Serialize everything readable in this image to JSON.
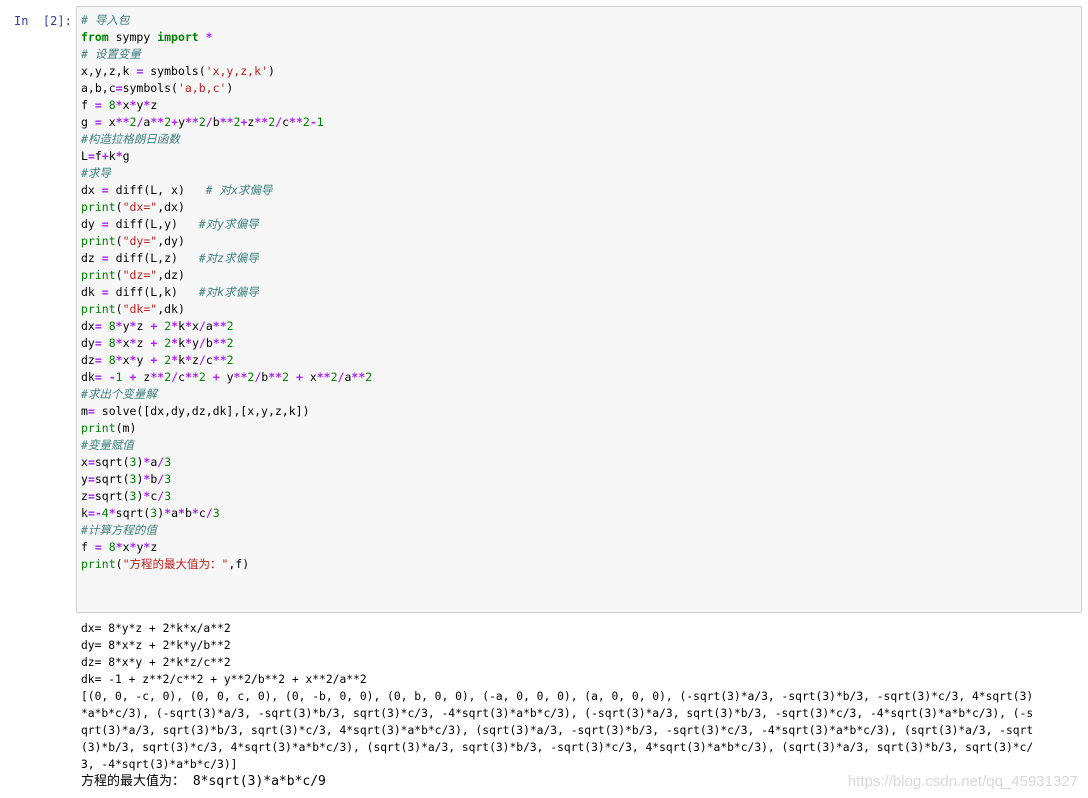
{
  "cell": {
    "prompt": "In  [2]:",
    "code_lines": [
      [
        [
          "c",
          "# 导入包"
        ]
      ],
      [
        [
          "k",
          "from"
        ],
        [
          "v",
          " sympy "
        ],
        [
          "k",
          "import"
        ],
        [
          "v",
          " "
        ],
        [
          "o",
          "*"
        ]
      ],
      [
        [
          "c",
          "# 设置变量"
        ]
      ],
      [
        [
          "v",
          "x,y,z,k "
        ],
        [
          "o",
          "="
        ],
        [
          "v",
          " symbols("
        ],
        [
          "s",
          "'x,y,z,k'"
        ],
        [
          "v",
          ")"
        ]
      ],
      [
        [
          "v",
          "a,b,c"
        ],
        [
          "o",
          "="
        ],
        [
          "v",
          "symbols("
        ],
        [
          "s",
          "'a,b,c'"
        ],
        [
          "v",
          ")"
        ]
      ],
      [
        [
          "v",
          "f "
        ],
        [
          "o",
          "="
        ],
        [
          "v",
          " "
        ],
        [
          "n",
          "8"
        ],
        [
          "o",
          "*"
        ],
        [
          "v",
          "x"
        ],
        [
          "o",
          "*"
        ],
        [
          "v",
          "y"
        ],
        [
          "o",
          "*"
        ],
        [
          "v",
          "z"
        ]
      ],
      [
        [
          "v",
          "g "
        ],
        [
          "o",
          "="
        ],
        [
          "v",
          " x"
        ],
        [
          "o",
          "**"
        ],
        [
          "n",
          "2"
        ],
        [
          "o",
          "/"
        ],
        [
          "v",
          "a"
        ],
        [
          "o",
          "**"
        ],
        [
          "n",
          "2"
        ],
        [
          "o",
          "+"
        ],
        [
          "v",
          "y"
        ],
        [
          "o",
          "**"
        ],
        [
          "n",
          "2"
        ],
        [
          "o",
          "/"
        ],
        [
          "v",
          "b"
        ],
        [
          "o",
          "**"
        ],
        [
          "n",
          "2"
        ],
        [
          "o",
          "+"
        ],
        [
          "v",
          "z"
        ],
        [
          "o",
          "**"
        ],
        [
          "n",
          "2"
        ],
        [
          "o",
          "/"
        ],
        [
          "v",
          "c"
        ],
        [
          "o",
          "**"
        ],
        [
          "n",
          "2"
        ],
        [
          "o",
          "-"
        ],
        [
          "n",
          "1"
        ]
      ],
      [
        [
          "c",
          "#构造拉格朗日函数"
        ]
      ],
      [
        [
          "v",
          "L"
        ],
        [
          "o",
          "="
        ],
        [
          "v",
          "f"
        ],
        [
          "o",
          "+"
        ],
        [
          "v",
          "k"
        ],
        [
          "o",
          "*"
        ],
        [
          "v",
          "g"
        ]
      ],
      [
        [
          "c",
          "#求导"
        ]
      ],
      [
        [
          "v",
          "dx "
        ],
        [
          "o",
          "="
        ],
        [
          "v",
          " diff(L, x)   "
        ],
        [
          "c",
          "# 对x求偏导"
        ]
      ],
      [
        [
          "b",
          "print"
        ],
        [
          "v",
          "("
        ],
        [
          "s",
          "\"dx=\""
        ],
        [
          "v",
          ",dx)"
        ]
      ],
      [
        [
          "v",
          "dy "
        ],
        [
          "o",
          "="
        ],
        [
          "v",
          " diff(L,y)   "
        ],
        [
          "c",
          "#对y求偏导"
        ]
      ],
      [
        [
          "b",
          "print"
        ],
        [
          "v",
          "("
        ],
        [
          "s",
          "\"dy=\""
        ],
        [
          "v",
          ",dy)"
        ]
      ],
      [
        [
          "v",
          "dz "
        ],
        [
          "o",
          "="
        ],
        [
          "v",
          " diff(L,z)   "
        ],
        [
          "c",
          "#对z求偏导"
        ]
      ],
      [
        [
          "b",
          "print"
        ],
        [
          "v",
          "("
        ],
        [
          "s",
          "\"dz=\""
        ],
        [
          "v",
          ",dz)"
        ]
      ],
      [
        [
          "v",
          "dk "
        ],
        [
          "o",
          "="
        ],
        [
          "v",
          " diff(L,k)   "
        ],
        [
          "c",
          "#对k求偏导"
        ]
      ],
      [
        [
          "b",
          "print"
        ],
        [
          "v",
          "("
        ],
        [
          "s",
          "\"dk=\""
        ],
        [
          "v",
          ",dk)"
        ]
      ],
      [
        [
          "v",
          "dx"
        ],
        [
          "o",
          "="
        ],
        [
          "v",
          " "
        ],
        [
          "n",
          "8"
        ],
        [
          "o",
          "*"
        ],
        [
          "v",
          "y"
        ],
        [
          "o",
          "*"
        ],
        [
          "v",
          "z "
        ],
        [
          "o",
          "+"
        ],
        [
          "v",
          " "
        ],
        [
          "n",
          "2"
        ],
        [
          "o",
          "*"
        ],
        [
          "v",
          "k"
        ],
        [
          "o",
          "*"
        ],
        [
          "v",
          "x"
        ],
        [
          "o",
          "/"
        ],
        [
          "v",
          "a"
        ],
        [
          "o",
          "**"
        ],
        [
          "n",
          "2"
        ]
      ],
      [
        [
          "v",
          "dy"
        ],
        [
          "o",
          "="
        ],
        [
          "v",
          " "
        ],
        [
          "n",
          "8"
        ],
        [
          "o",
          "*"
        ],
        [
          "v",
          "x"
        ],
        [
          "o",
          "*"
        ],
        [
          "v",
          "z "
        ],
        [
          "o",
          "+"
        ],
        [
          "v",
          " "
        ],
        [
          "n",
          "2"
        ],
        [
          "o",
          "*"
        ],
        [
          "v",
          "k"
        ],
        [
          "o",
          "*"
        ],
        [
          "v",
          "y"
        ],
        [
          "o",
          "/"
        ],
        [
          "v",
          "b"
        ],
        [
          "o",
          "**"
        ],
        [
          "n",
          "2"
        ]
      ],
      [
        [
          "v",
          "dz"
        ],
        [
          "o",
          "="
        ],
        [
          "v",
          " "
        ],
        [
          "n",
          "8"
        ],
        [
          "o",
          "*"
        ],
        [
          "v",
          "x"
        ],
        [
          "o",
          "*"
        ],
        [
          "v",
          "y "
        ],
        [
          "o",
          "+"
        ],
        [
          "v",
          " "
        ],
        [
          "n",
          "2"
        ],
        [
          "o",
          "*"
        ],
        [
          "v",
          "k"
        ],
        [
          "o",
          "*"
        ],
        [
          "v",
          "z"
        ],
        [
          "o",
          "/"
        ],
        [
          "v",
          "c"
        ],
        [
          "o",
          "**"
        ],
        [
          "n",
          "2"
        ]
      ],
      [
        [
          "v",
          "dk"
        ],
        [
          "o",
          "="
        ],
        [
          "v",
          " "
        ],
        [
          "o",
          "-"
        ],
        [
          "n",
          "1"
        ],
        [
          "v",
          " "
        ],
        [
          "o",
          "+"
        ],
        [
          "v",
          " z"
        ],
        [
          "o",
          "**"
        ],
        [
          "n",
          "2"
        ],
        [
          "o",
          "/"
        ],
        [
          "v",
          "c"
        ],
        [
          "o",
          "**"
        ],
        [
          "n",
          "2"
        ],
        [
          "v",
          " "
        ],
        [
          "o",
          "+"
        ],
        [
          "v",
          " y"
        ],
        [
          "o",
          "**"
        ],
        [
          "n",
          "2"
        ],
        [
          "o",
          "/"
        ],
        [
          "v",
          "b"
        ],
        [
          "o",
          "**"
        ],
        [
          "n",
          "2"
        ],
        [
          "v",
          " "
        ],
        [
          "o",
          "+"
        ],
        [
          "v",
          " x"
        ],
        [
          "o",
          "**"
        ],
        [
          "n",
          "2"
        ],
        [
          "o",
          "/"
        ],
        [
          "v",
          "a"
        ],
        [
          "o",
          "**"
        ],
        [
          "n",
          "2"
        ]
      ],
      [
        [
          "c",
          "#求出个变量解"
        ]
      ],
      [
        [
          "v",
          "m"
        ],
        [
          "o",
          "="
        ],
        [
          "v",
          " solve([dx,dy,dz,dk],[x,y,z,k])"
        ]
      ],
      [
        [
          "b",
          "print"
        ],
        [
          "v",
          "(m)"
        ]
      ],
      [
        [
          "c",
          "#变量赋值"
        ]
      ],
      [
        [
          "v",
          "x"
        ],
        [
          "o",
          "="
        ],
        [
          "v",
          "sqrt("
        ],
        [
          "n",
          "3"
        ],
        [
          "v",
          ")"
        ],
        [
          "o",
          "*"
        ],
        [
          "v",
          "a"
        ],
        [
          "o",
          "/"
        ],
        [
          "n",
          "3"
        ]
      ],
      [
        [
          "v",
          "y"
        ],
        [
          "o",
          "="
        ],
        [
          "v",
          "sqrt("
        ],
        [
          "n",
          "3"
        ],
        [
          "v",
          ")"
        ],
        [
          "o",
          "*"
        ],
        [
          "v",
          "b"
        ],
        [
          "o",
          "/"
        ],
        [
          "n",
          "3"
        ]
      ],
      [
        [
          "v",
          "z"
        ],
        [
          "o",
          "="
        ],
        [
          "v",
          "sqrt("
        ],
        [
          "n",
          "3"
        ],
        [
          "v",
          ")"
        ],
        [
          "o",
          "*"
        ],
        [
          "v",
          "c"
        ],
        [
          "o",
          "/"
        ],
        [
          "n",
          "3"
        ]
      ],
      [
        [
          "v",
          "k"
        ],
        [
          "o",
          "=-"
        ],
        [
          "n",
          "4"
        ],
        [
          "o",
          "*"
        ],
        [
          "v",
          "sqrt("
        ],
        [
          "n",
          "3"
        ],
        [
          "v",
          ")"
        ],
        [
          "o",
          "*"
        ],
        [
          "v",
          "a"
        ],
        [
          "o",
          "*"
        ],
        [
          "v",
          "b"
        ],
        [
          "o",
          "*"
        ],
        [
          "v",
          "c"
        ],
        [
          "o",
          "/"
        ],
        [
          "n",
          "3"
        ]
      ],
      [
        [
          "c",
          "#计算方程的值"
        ]
      ],
      [
        [
          "v",
          "f "
        ],
        [
          "o",
          "="
        ],
        [
          "v",
          " "
        ],
        [
          "n",
          "8"
        ],
        [
          "o",
          "*"
        ],
        [
          "v",
          "x"
        ],
        [
          "o",
          "*"
        ],
        [
          "v",
          "y"
        ],
        [
          "o",
          "*"
        ],
        [
          "v",
          "z"
        ]
      ],
      [
        [
          "b",
          "print"
        ],
        [
          "v",
          "("
        ],
        [
          "s",
          "\"方程的最大值为：\""
        ],
        [
          "v",
          ",f)"
        ]
      ]
    ],
    "output_lines": [
      "dx= 8*y*z + 2*k*x/a**2",
      "dy= 8*x*z + 2*k*y/b**2",
      "dz= 8*x*y + 2*k*z/c**2",
      "dk= -1 + z**2/c**2 + y**2/b**2 + x**2/a**2",
      "[(0, 0, -c, 0), (0, 0, c, 0), (0, -b, 0, 0), (0, b, 0, 0), (-a, 0, 0, 0), (a, 0, 0, 0), (-sqrt(3)*a/3, -sqrt(3)*b/3, -sqrt(3)*c/3, 4*sqrt(3)",
      "*a*b*c/3), (-sqrt(3)*a/3, -sqrt(3)*b/3, sqrt(3)*c/3, -4*sqrt(3)*a*b*c/3), (-sqrt(3)*a/3, sqrt(3)*b/3, -sqrt(3)*c/3, -4*sqrt(3)*a*b*c/3), (-s",
      "qrt(3)*a/3, sqrt(3)*b/3, sqrt(3)*c/3, 4*sqrt(3)*a*b*c/3), (sqrt(3)*a/3, -sqrt(3)*b/3, -sqrt(3)*c/3, -4*sqrt(3)*a*b*c/3), (sqrt(3)*a/3, -sqrt",
      "(3)*b/3, sqrt(3)*c/3, 4*sqrt(3)*a*b*c/3), (sqrt(3)*a/3, sqrt(3)*b/3, -sqrt(3)*c/3, 4*sqrt(3)*a*b*c/3), (sqrt(3)*a/3, sqrt(3)*b/3, sqrt(3)*c/",
      "3, -4*sqrt(3)*a*b*c/3)]",
      "方程的最大值为： 8*sqrt(3)*a*b*c/9"
    ]
  },
  "watermark": "https://blog.csdn.net/qq_45931327",
  "colors": {
    "comment": "#408080",
    "keyword": "#008000",
    "operator": "#aa22ff",
    "number": "#008000",
    "string": "#ba2121",
    "prompt": "#303f9f",
    "cell_background": "#f7f7f7"
  }
}
